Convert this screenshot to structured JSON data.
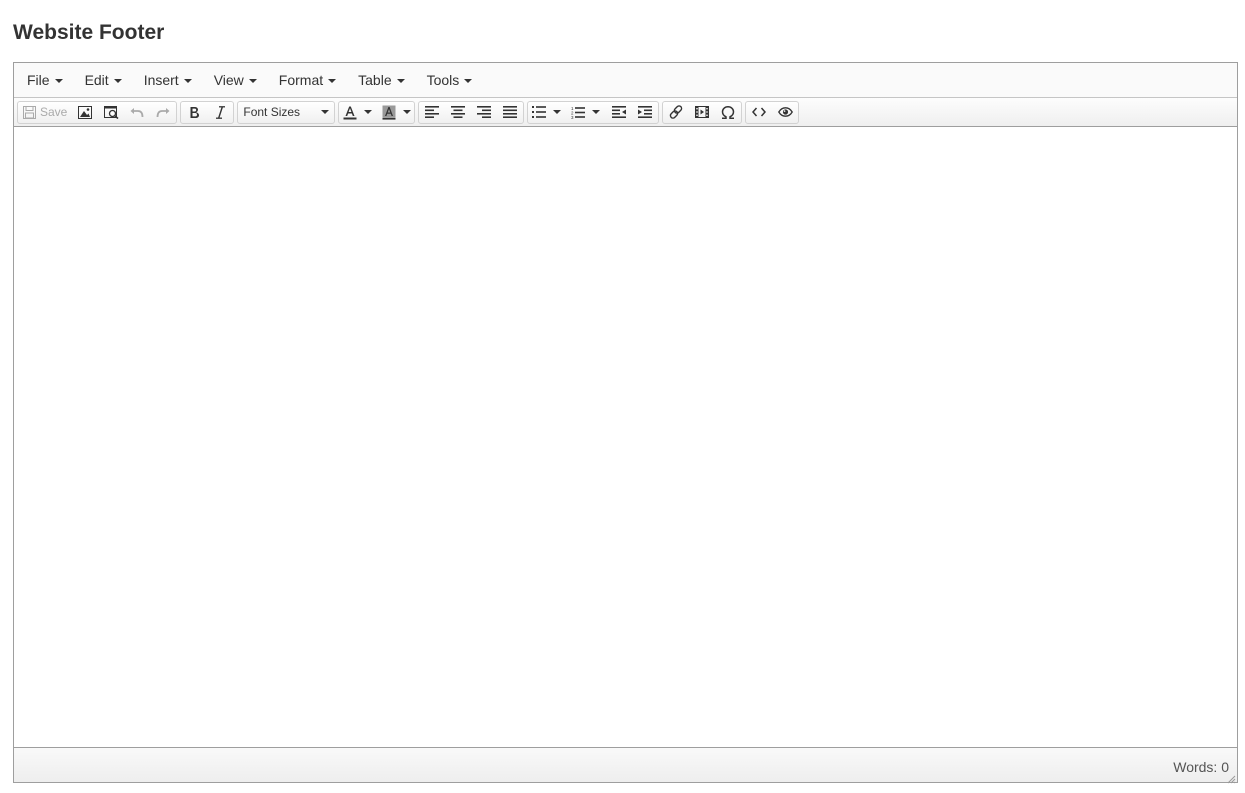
{
  "page": {
    "title": "Website Footer"
  },
  "menubar": {
    "items": [
      {
        "label": "File"
      },
      {
        "label": "Edit"
      },
      {
        "label": "Insert"
      },
      {
        "label": "View"
      },
      {
        "label": "Format"
      },
      {
        "label": "Table"
      },
      {
        "label": "Tools"
      }
    ]
  },
  "toolbar": {
    "save_label": "Save",
    "font_sizes_label": "Font Sizes",
    "icons": [
      "save-icon",
      "image-icon",
      "preview-icon",
      "undo-icon",
      "redo-icon",
      "bold-icon",
      "italic-icon",
      "text-color-icon",
      "background-color-icon",
      "align-left-icon",
      "align-center-icon",
      "align-right-icon",
      "align-justify-icon",
      "bullet-list-icon",
      "numbered-list-icon",
      "outdent-icon",
      "indent-icon",
      "link-icon",
      "media-icon",
      "special-character-icon",
      "source-code-icon",
      "preview-eye-icon"
    ]
  },
  "statusbar": {
    "word_count": "Words: 0"
  },
  "colors": {
    "border": "#9e9e9e",
    "text": "#333333",
    "disabled": "#aaaaaa"
  }
}
